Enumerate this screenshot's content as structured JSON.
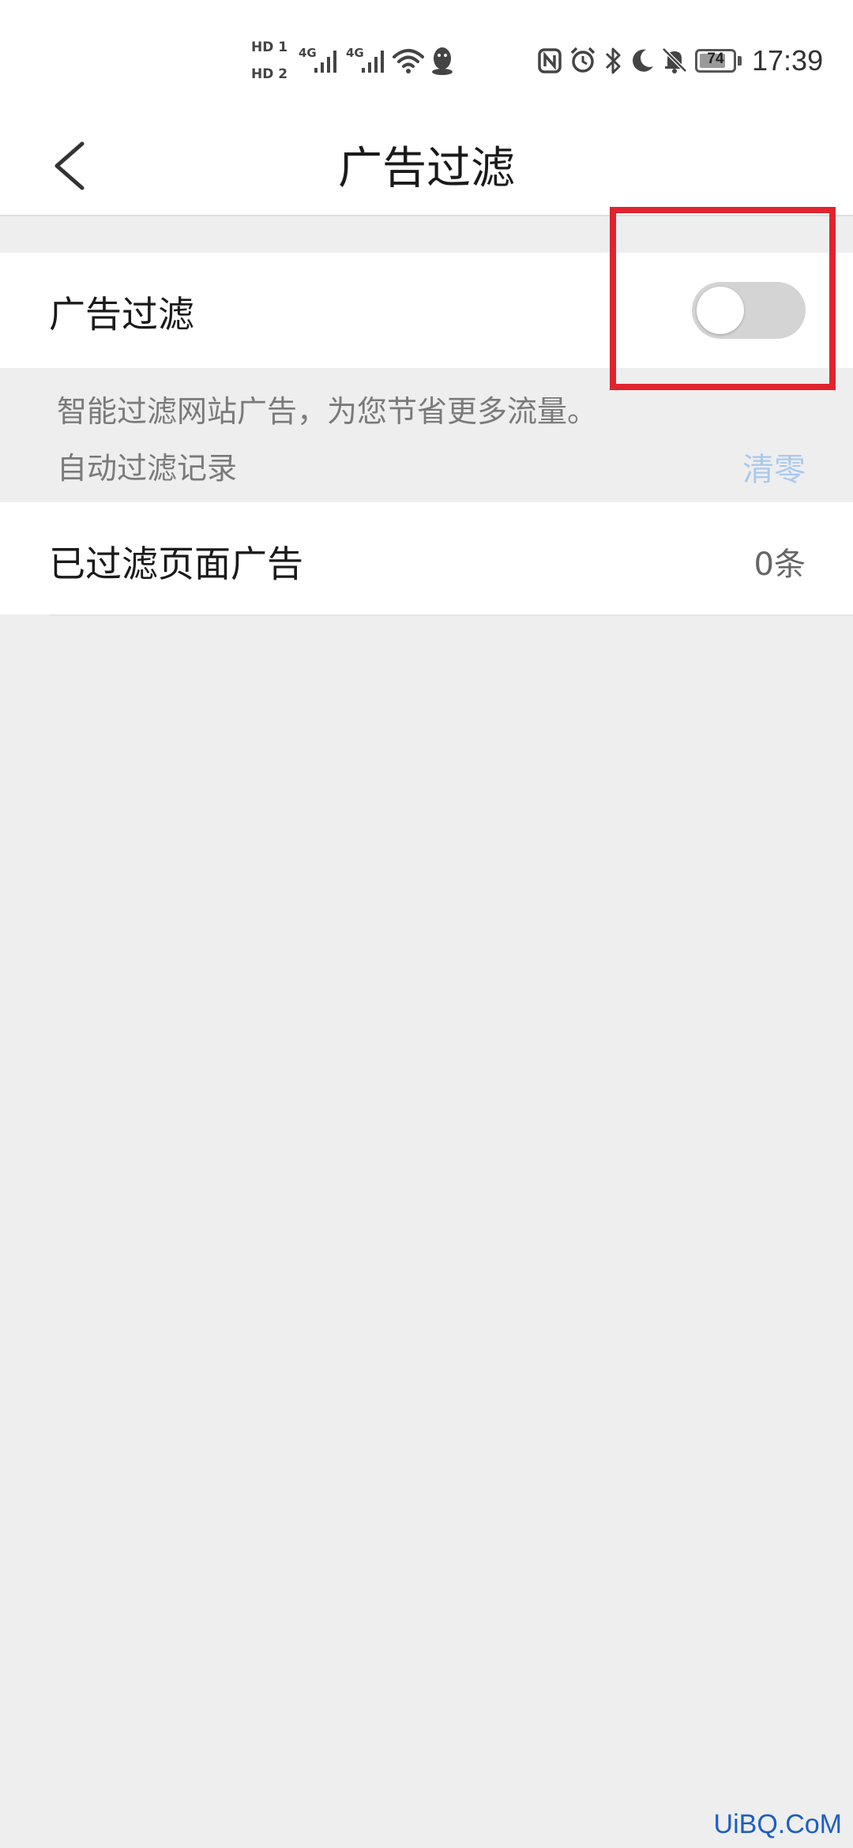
{
  "status_bar": {
    "sim1_label": "HD 1",
    "sim2_label": "HD 2",
    "network1": "4G",
    "network2": "4G",
    "battery_level": "74",
    "time": "17:39",
    "icons": [
      "wifi-icon",
      "qq-icon",
      "nfc-icon",
      "alarm-icon",
      "bluetooth-icon",
      "moon-icon",
      "mute-icon",
      "battery-icon"
    ]
  },
  "header": {
    "title": "广告过滤",
    "back_icon": "chevron-left-icon"
  },
  "ad_filter": {
    "label": "广告过滤",
    "enabled": false
  },
  "description": {
    "text": "智能过滤网站广告，为您节省更多流量。",
    "record_label": "自动过滤记录",
    "clear_label": "清零"
  },
  "filtered_pages": {
    "label": "已过滤页面广告",
    "count": "0条"
  },
  "colors": {
    "highlight": "#e0232e",
    "clear_link": "#a9c9ee",
    "toggle_off": "#d4d4d4",
    "background": "#eeeeee"
  },
  "watermark": "UiBQ.CoM"
}
